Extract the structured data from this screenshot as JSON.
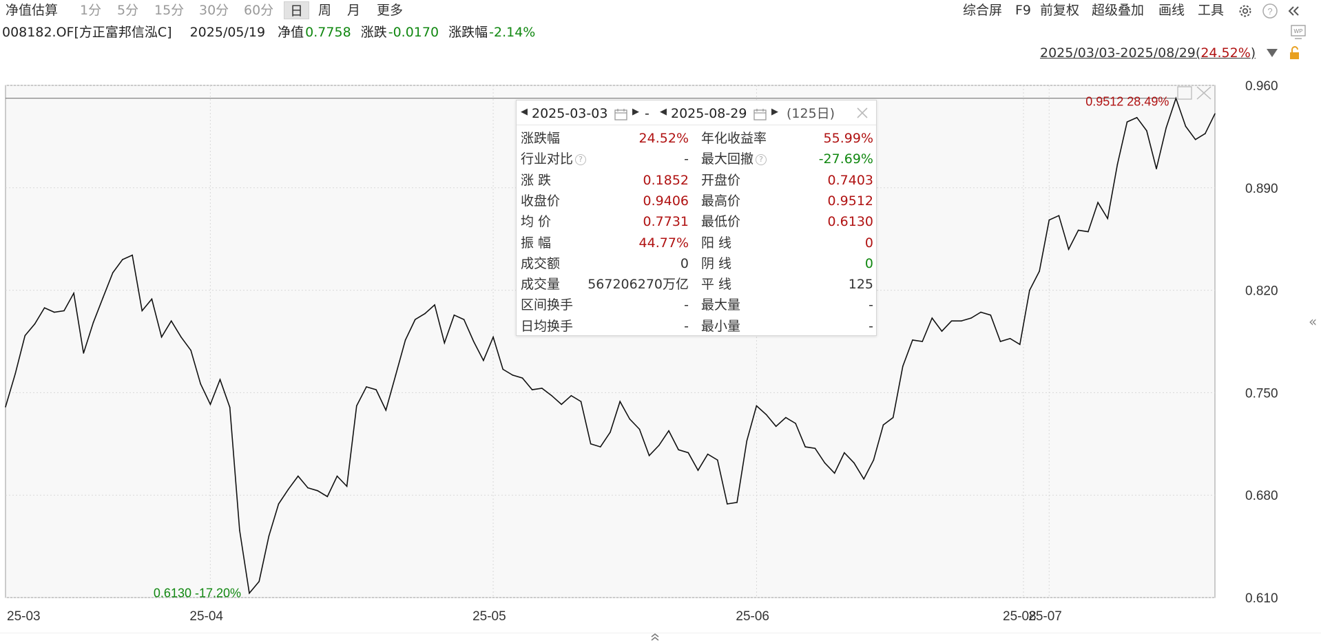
{
  "toolbar": {
    "periods": [
      "净值估算",
      "1分",
      "5分",
      "15分",
      "30分",
      "60分",
      "日",
      "周",
      "月",
      "更多"
    ],
    "tools": [
      "综合屏",
      "F9",
      "前复权",
      "超级叠加",
      "画线",
      "工具"
    ],
    "icons": [
      "gear-icon",
      "help-icon",
      "collapse-icon"
    ]
  },
  "info": {
    "fund": "008182.OF[方正富邦信泓C]",
    "date": "2025/05/19",
    "nav_label": "净值",
    "nav_value": "0.7758",
    "change_label": "涨跌",
    "change_value": "-0.0170",
    "pct_label": "涨跌幅",
    "pct_value": "-2.14%"
  },
  "range": {
    "text": "2025/03/03-2025/08/29",
    "pct": "24.52%"
  },
  "chart_data": {
    "type": "line",
    "ylim": [
      0.61,
      0.96
    ],
    "yticks": [
      "0.960",
      "0.890",
      "0.820",
      "0.750",
      "0.680",
      "0.610"
    ],
    "xticks": [
      "25-03",
      "25-04",
      "25-05",
      "25-06",
      "25-07",
      "25-08"
    ],
    "grid": true,
    "max_label": "0.9512 28.49%",
    "min_label": "0.6130 -17.20%",
    "values": [
      0.7403,
      0.763,
      0.789,
      0.797,
      0.808,
      0.805,
      0.806,
      0.818,
      0.777,
      0.798,
      0.815,
      0.832,
      0.841,
      0.844,
      0.806,
      0.814,
      0.788,
      0.799,
      0.788,
      0.779,
      0.756,
      0.742,
      0.759,
      0.74,
      0.656,
      0.613,
      0.621,
      0.652,
      0.674,
      0.684,
      0.693,
      0.685,
      0.683,
      0.679,
      0.693,
      0.686,
      0.741,
      0.754,
      0.752,
      0.738,
      0.762,
      0.786,
      0.8,
      0.804,
      0.81,
      0.784,
      0.803,
      0.8,
      0.785,
      0.772,
      0.788,
      0.766,
      0.762,
      0.76,
      0.752,
      0.753,
      0.748,
      0.742,
      0.748,
      0.744,
      0.715,
      0.713,
      0.723,
      0.744,
      0.732,
      0.725,
      0.707,
      0.714,
      0.724,
      0.711,
      0.709,
      0.697,
      0.708,
      0.704,
      0.674,
      0.675,
      0.717,
      0.741,
      0.735,
      0.727,
      0.733,
      0.729,
      0.713,
      0.712,
      0.702,
      0.695,
      0.709,
      0.702,
      0.691,
      0.704,
      0.728,
      0.733,
      0.768,
      0.786,
      0.785,
      0.801,
      0.792,
      0.799,
      0.799,
      0.801,
      0.805,
      0.803,
      0.785,
      0.787,
      0.783,
      0.82,
      0.833,
      0.868,
      0.871,
      0.848,
      0.861,
      0.86,
      0.88,
      0.869,
      0.906,
      0.935,
      0.938,
      0.929,
      0.903,
      0.931,
      0.9512,
      0.932,
      0.923,
      0.927,
      0.9406
    ]
  },
  "popup": {
    "start": "2025-03-03",
    "sep": "-",
    "end": "2025-08-29",
    "days": "(125日)",
    "rows": [
      {
        "l1": "涨跌幅",
        "v1": "24.52%",
        "c1": "#b01212",
        "l2": "年化收益率",
        "v2": "55.99%",
        "c2": "#b01212",
        "q1": false,
        "q2": false
      },
      {
        "l1": "行业对比",
        "v1": "-",
        "c1": "#333333",
        "l2": "最大回撤",
        "v2": "-27.69%",
        "c2": "#118811",
        "q1": true,
        "q2": true
      },
      {
        "l1": "涨  跌",
        "v1": "0.1852",
        "c1": "#b01212",
        "l2": "开盘价",
        "v2": "0.7403",
        "c2": "#b01212",
        "q1": false,
        "q2": false
      },
      {
        "l1": "收盘价",
        "v1": "0.9406",
        "c1": "#b01212",
        "l2": "最高价",
        "v2": "0.9512",
        "c2": "#b01212",
        "q1": false,
        "q2": false
      },
      {
        "l1": "均  价",
        "v1": "0.7731",
        "c1": "#b01212",
        "l2": "最低价",
        "v2": "0.6130",
        "c2": "#b01212",
        "q1": false,
        "q2": false
      },
      {
        "l1": "振  幅",
        "v1": "44.77%",
        "c1": "#b01212",
        "l2": "阳  线",
        "v2": "0",
        "c2": "#b01212",
        "q1": false,
        "q2": false
      },
      {
        "l1": "成交额",
        "v1": "0",
        "c1": "#333333",
        "l2": "阴  线",
        "v2": "0",
        "c2": "#118811",
        "q1": false,
        "q2": false
      },
      {
        "l1": "成交量",
        "v1": "567206270万亿",
        "c1": "#333333",
        "l2": "平  线",
        "v2": "125",
        "c2": "#333333",
        "q1": false,
        "q2": false
      },
      {
        "l1": "区间换手",
        "v1": "-",
        "c1": "#333333",
        "l2": "最大量",
        "v2": "-",
        "c2": "#333333",
        "q1": false,
        "q2": false
      },
      {
        "l1": "日均换手",
        "v1": "-",
        "c1": "#333333",
        "l2": "最小量",
        "v2": "-",
        "c2": "#333333",
        "q1": false,
        "q2": false
      }
    ]
  },
  "colors": {
    "line": "#111111",
    "up": "#b01212",
    "down": "#118811",
    "grid": "#d8d8d8",
    "plot_bg": "#f8f8f8"
  }
}
